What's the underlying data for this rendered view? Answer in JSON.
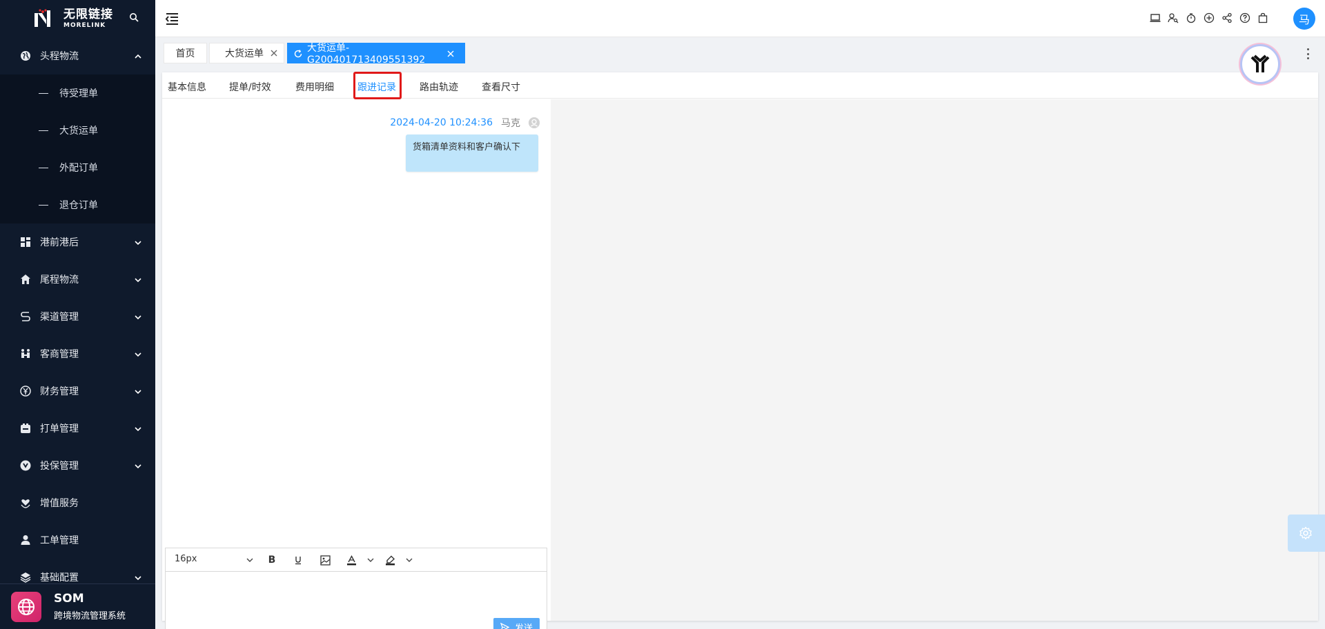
{
  "brand": {
    "name_cn": "无限链接",
    "name_en": "MORELINK"
  },
  "sidebar": {
    "groups": [
      {
        "label": "头程物流",
        "icon": "globe-icon",
        "expanded": true
      },
      {
        "label": "港前港后",
        "icon": "dashboard-icon"
      },
      {
        "label": "尾程物流",
        "icon": "home-icon"
      },
      {
        "label": "渠道管理",
        "icon": "route-icon"
      },
      {
        "label": "客商管理",
        "icon": "users-icon"
      },
      {
        "label": "财务管理",
        "icon": "yen-icon"
      },
      {
        "label": "打单管理",
        "icon": "printer-icon"
      },
      {
        "label": "投保管理",
        "icon": "shield-icon"
      },
      {
        "label": "增值服务",
        "icon": "heart-hand-icon"
      },
      {
        "label": "工单管理",
        "icon": "person-icon"
      },
      {
        "label": "基础配置",
        "icon": "layers-icon"
      }
    ],
    "sub_items": [
      "待受理单",
      "大货运单",
      "外配订单",
      "退仓订单"
    ],
    "footer": {
      "system_name": "SOM",
      "system_desc": "跨境物流管理系统"
    }
  },
  "topbar": {
    "icons": [
      "laptop-icon",
      "user-search-icon",
      "timer-icon",
      "globe-plus-icon",
      "share-icon",
      "help-icon",
      "bag-icon"
    ],
    "user_initial": "马"
  },
  "tabs": [
    {
      "label": "首页"
    },
    {
      "label": "大货运单"
    },
    {
      "label": "大货运单-G200401713409551392",
      "active": true
    }
  ],
  "subtabs": [
    {
      "label": "基本信息"
    },
    {
      "label": "提单/时效"
    },
    {
      "label": "费用明细"
    },
    {
      "label": "跟进记录",
      "active": true
    },
    {
      "label": "路由轨迹"
    },
    {
      "label": "查看尺寸"
    }
  ],
  "messages": [
    {
      "time": "2024-04-20 10:24:36",
      "author": "马克",
      "text": "货箱清单资料和客户确认下"
    }
  ],
  "editor": {
    "font_size": "16px",
    "send_label": "发送"
  },
  "colors": {
    "primary": "#1e90ff",
    "sidebar_bg": "#0f1a2c",
    "highlight": "#e01919",
    "bubble": "#bfe5fb"
  }
}
